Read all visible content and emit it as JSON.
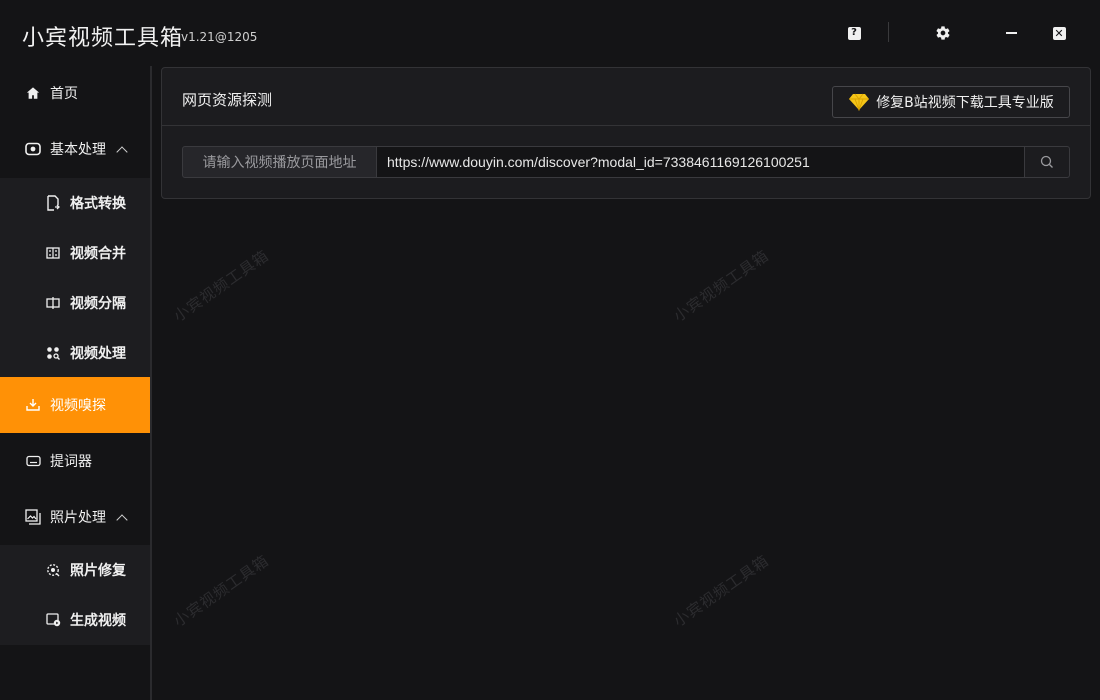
{
  "app": {
    "title": "小宾视频工具箱",
    "version": "v1.21@1205"
  },
  "sidebar": {
    "items": [
      {
        "label": "首页",
        "icon": "home-icon"
      },
      {
        "label": "基本处理",
        "icon": "video-icon"
      },
      {
        "label": "格式转换",
        "icon": "file-convert-icon"
      },
      {
        "label": "视频合并",
        "icon": "merge-icon"
      },
      {
        "label": "视频分隔",
        "icon": "split-icon"
      },
      {
        "label": "视频处理",
        "icon": "process-icon"
      },
      {
        "label": "视频嗅探",
        "icon": "download-icon"
      },
      {
        "label": "提词器",
        "icon": "keyboard-icon"
      },
      {
        "label": "照片处理",
        "icon": "photos-icon"
      },
      {
        "label": "照片修复",
        "icon": "photo-repair-icon"
      },
      {
        "label": "生成视频",
        "icon": "photo-to-video-icon"
      }
    ],
    "active": "视频嗅探"
  },
  "main": {
    "panel_title": "网页资源探测",
    "pro_button_label": "修复B站视频下载工具专业版",
    "url_prefix": "请输入视频播放页面地址",
    "url_value": "https://www.douyin.com/discover?modal_id=7338461169126100251"
  },
  "watermark": "小宾视频工具箱",
  "colors": {
    "accent": "#ff9106",
    "background": "#141416",
    "panel": "#1c1c1f"
  }
}
